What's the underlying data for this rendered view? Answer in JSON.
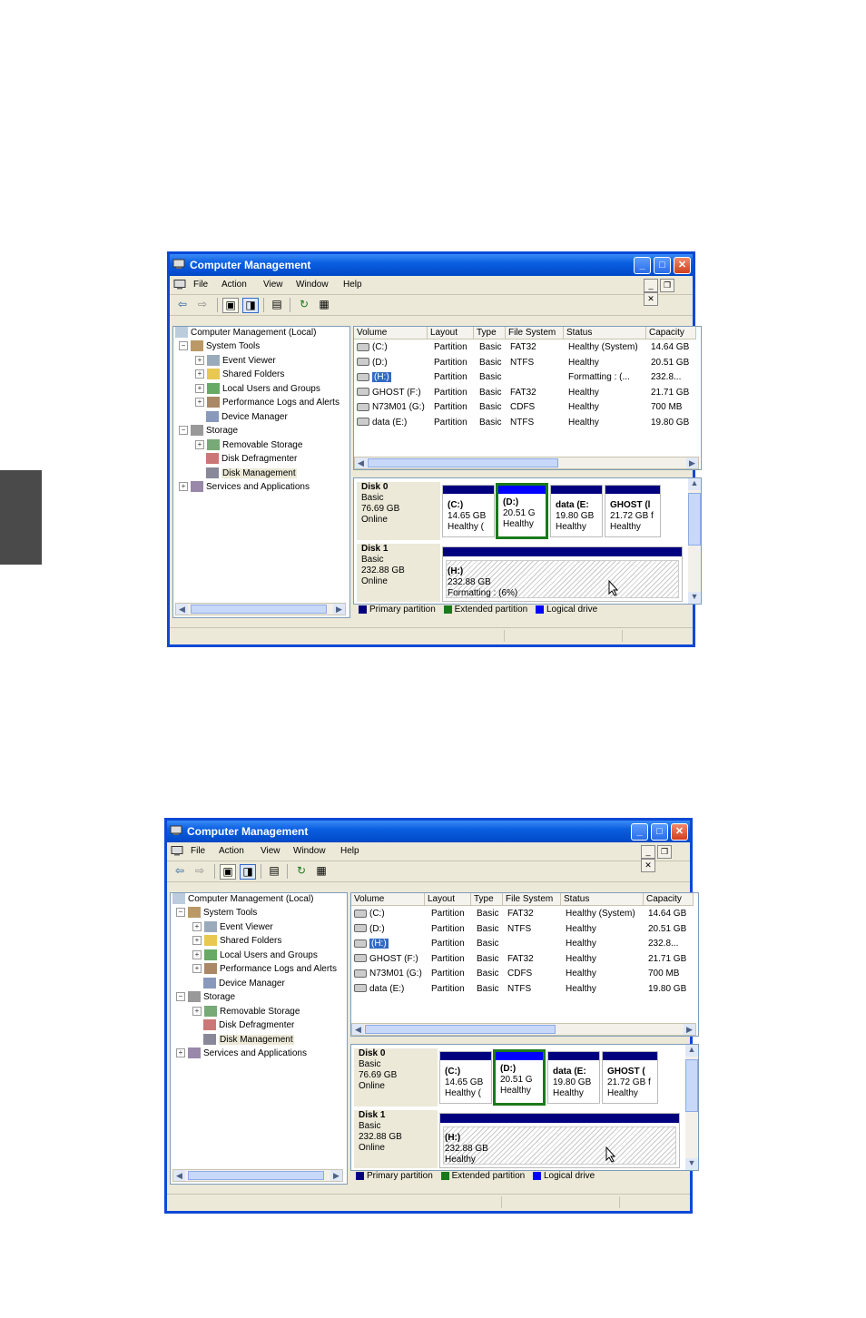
{
  "windows": [
    {
      "title": "Computer Management",
      "menu": [
        "File",
        "Action",
        "View",
        "Window",
        "Help"
      ],
      "tree": {
        "root": "Computer Management (Local)",
        "system_tools": "System Tools",
        "event_viewer": "Event Viewer",
        "shared_folders": "Shared Folders",
        "local_users": "Local Users and Groups",
        "perf_logs": "Performance Logs and Alerts",
        "device_manager": "Device Manager",
        "storage": "Storage",
        "removable": "Removable Storage",
        "defrag": "Disk Defragmenter",
        "disk_mgmt": "Disk Management",
        "services": "Services and Applications"
      },
      "columns": [
        "Volume",
        "Layout",
        "Type",
        "File System",
        "Status",
        "Capacity"
      ],
      "rows": [
        [
          "(C:)",
          "Partition",
          "Basic",
          "FAT32",
          "Healthy (System)",
          "14.64 GB"
        ],
        [
          "(D:)",
          "Partition",
          "Basic",
          "NTFS",
          "Healthy",
          "20.51 GB"
        ],
        [
          "(H:)",
          "Partition",
          "Basic",
          "",
          "Formatting : (...",
          "232.8..."
        ],
        [
          "GHOST (F:)",
          "Partition",
          "Basic",
          "FAT32",
          "Healthy",
          "21.71 GB"
        ],
        [
          "N73M01 (G:)",
          "Partition",
          "Basic",
          "CDFS",
          "Healthy",
          "700 MB"
        ],
        [
          "data (E:)",
          "Partition",
          "Basic",
          "NTFS",
          "Healthy",
          "19.80 GB"
        ]
      ],
      "disk0": {
        "name": "Disk 0",
        "type": "Basic",
        "size": "76.69 GB",
        "state": "Online",
        "parts": [
          {
            "label": "(C:)",
            "size": "14.65 GB",
            "status": "Healthy ("
          },
          {
            "label": "(D:)",
            "size": "20.51 G",
            "status": "Healthy"
          },
          {
            "label": "data  (E:",
            "size": "19.80 GB",
            "status": "Healthy"
          },
          {
            "label": "GHOST  (l",
            "size": "21.72 GB f",
            "status": "Healthy"
          }
        ]
      },
      "disk1": {
        "name": "Disk 1",
        "type": "Basic",
        "size": "232.88 GB",
        "state": "Online",
        "part": {
          "label": "(H:)",
          "size": "232.88 GB",
          "status": "Formatting : (6%)"
        }
      },
      "legend": [
        "Primary partition",
        "Extended partition",
        "Logical drive"
      ]
    },
    {
      "title": "Computer Management",
      "menu": [
        "File",
        "Action",
        "View",
        "Window",
        "Help"
      ],
      "tree": {
        "root": "Computer Management (Local)",
        "system_tools": "System Tools",
        "event_viewer": "Event Viewer",
        "shared_folders": "Shared Folders",
        "local_users": "Local Users and Groups",
        "perf_logs": "Performance Logs and Alerts",
        "device_manager": "Device Manager",
        "storage": "Storage",
        "removable": "Removable Storage",
        "defrag": "Disk Defragmenter",
        "disk_mgmt": "Disk Management",
        "services": "Services and Applications"
      },
      "columns": [
        "Volume",
        "Layout",
        "Type",
        "File System",
        "Status",
        "Capacity"
      ],
      "rows": [
        [
          "(C:)",
          "Partition",
          "Basic",
          "FAT32",
          "Healthy (System)",
          "14.64 GB"
        ],
        [
          "(D:)",
          "Partition",
          "Basic",
          "NTFS",
          "Healthy",
          "20.51 GB"
        ],
        [
          "(H:)",
          "Partition",
          "Basic",
          "",
          "Healthy",
          "232.8..."
        ],
        [
          "GHOST (F:)",
          "Partition",
          "Basic",
          "FAT32",
          "Healthy",
          "21.71 GB"
        ],
        [
          "N73M01 (G:)",
          "Partition",
          "Basic",
          "CDFS",
          "Healthy",
          "700 MB"
        ],
        [
          "data (E:)",
          "Partition",
          "Basic",
          "NTFS",
          "Healthy",
          "19.80 GB"
        ]
      ],
      "disk0": {
        "name": "Disk 0",
        "type": "Basic",
        "size": "76.69 GB",
        "state": "Online",
        "parts": [
          {
            "label": "(C:)",
            "size": "14.65 GB",
            "status": "Healthy ("
          },
          {
            "label": "(D:)",
            "size": "20.51 G",
            "status": "Healthy"
          },
          {
            "label": "data  (E:",
            "size": "19.80 GB",
            "status": "Healthy"
          },
          {
            "label": "GHOST  (",
            "size": "21.72 GB f",
            "status": "Healthy"
          }
        ]
      },
      "disk1": {
        "name": "Disk 1",
        "type": "Basic",
        "size": "232.88 GB",
        "state": "Online",
        "part": {
          "label": "(H:)",
          "size": "232.88 GB",
          "status": "Healthy"
        }
      },
      "legend": [
        "Primary partition",
        "Extended partition",
        "Logical drive"
      ]
    }
  ],
  "colors": {
    "primary": "#00007f",
    "extended": "#1a7a1a",
    "logical": "#0000ff",
    "side_tab": "#4a4a4a"
  }
}
